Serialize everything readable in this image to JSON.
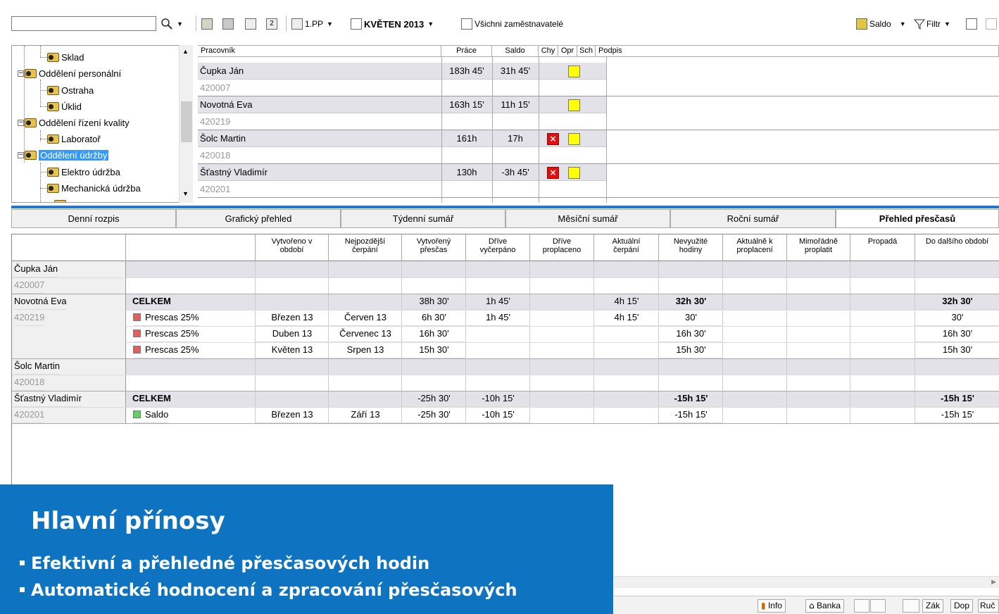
{
  "toolbar": {
    "pp_label": "1.PP",
    "month_label": "KVĚTEN 2013",
    "employers_label": "Všichni zaměstnavatelé",
    "saldo_label": "Saldo",
    "filter_label": "Filtr"
  },
  "tree": {
    "items": [
      {
        "label": "Sklad"
      },
      {
        "label": "Oddělení personální"
      },
      {
        "label": "Ostraha"
      },
      {
        "label": "Úklid"
      },
      {
        "label": "Oddělení řízení kvality"
      },
      {
        "label": "Laboratoř"
      },
      {
        "label": "Oddělení údržby"
      },
      {
        "label": "Elektro údržba"
      },
      {
        "label": "Mechanická údržba"
      }
    ]
  },
  "employees": {
    "headers": {
      "name": "Pracovník",
      "work": "Práce",
      "saldo": "Saldo",
      "chy": "Chy",
      "opr": "Opr",
      "sch": "Sch",
      "signature": "Podpis"
    },
    "rows": [
      {
        "name": "Čupka Ján",
        "id": "420007",
        "work": "183h 45'",
        "saldo": "31h 45'",
        "error": false
      },
      {
        "name": "Novotná Eva",
        "id": "420219",
        "work": "163h 15'",
        "saldo": "11h 15'",
        "error": false
      },
      {
        "name": "Šolc Martin",
        "id": "420018",
        "work": "161h",
        "saldo": "17h",
        "error": true
      },
      {
        "name": "Šťastný Vladimír",
        "id": "420201",
        "work": "130h",
        "saldo": "-3h 45'",
        "error": true
      }
    ]
  },
  "tabs": [
    "Denní rozpis",
    "Grafický přehled",
    "Týdenní sumář",
    "Měsíční sumář",
    "Roční sumář",
    "Přehled přesčasů"
  ],
  "grid": {
    "headers": [
      "Vytvořeno v\nobdobí",
      "Nejpozdější\nčerpání",
      "Vytvořený\npřesčas",
      "Dříve\nvyčerpáno",
      "Dříve\nproplaceno",
      "Aktuální\nčerpání",
      "Nevyužité\nhodiny",
      "Aktuálně k\nproplacení",
      "Mimořádně\nproplatit",
      "Propadá",
      "Do dalšího období"
    ],
    "people": [
      {
        "name": "Čupka Ján",
        "id": "420007"
      },
      {
        "name": "Novotná Eva",
        "id": "420219"
      },
      {
        "name": "Šolc Martin",
        "id": "420018"
      },
      {
        "name": "Šťastný Vladimír",
        "id": "420201"
      }
    ],
    "rows": {
      "eva_total": {
        "label": "CELKEM",
        "created": "38h 30'",
        "used_before": "1h 45'",
        "current_use": "4h 15'",
        "unused": "32h 30'",
        "next": "32h 30'"
      },
      "eva_r1": {
        "label": "Prescas 25%",
        "period": "Březen 13",
        "latest": "Červen 13",
        "created": "6h 30'",
        "used_before": "1h 45'",
        "current_use": "4h 15'",
        "unused": "30'",
        "next": "30'"
      },
      "eva_r2": {
        "label": "Prescas 25%",
        "period": "Duben 13",
        "latest": "Červenec 13",
        "created": "16h 30'",
        "unused": "16h 30'",
        "next": "16h 30'"
      },
      "eva_r3": {
        "label": "Prescas 25%",
        "period": "Květen 13",
        "latest": "Srpen 13",
        "created": "15h 30'",
        "unused": "15h 30'",
        "next": "15h 30'"
      },
      "vlad_total": {
        "label": "CELKEM",
        "created": "-25h 30'",
        "used_before": "-10h 15'",
        "unused": "-15h 15'",
        "next": "-15h 15'"
      },
      "vlad_r1": {
        "label": "Saldo",
        "period": "Březen 13",
        "latest": "Září 13",
        "created": "-25h 30'",
        "used_before": "-10h 15'",
        "unused": "-15h 15'",
        "next": "-15h 15'"
      }
    }
  },
  "statusbar": {
    "info": "Info",
    "bank": "Banka",
    "zak": "Zák",
    "dop": "Dop",
    "ruc": "Ruč"
  },
  "overlay": {
    "title": "Hlavní přínosy",
    "bullets": [
      "Efektivní a přehledné přesčasových hodin",
      "Automatické hodnocení a zpracování přesčasových"
    ]
  },
  "colors": {
    "accent": "#1f78c8",
    "overlay": "#0e74c1",
    "overtime_square": "#e06060",
    "saldo_square": "#60d060",
    "selection": "#3399ff"
  }
}
